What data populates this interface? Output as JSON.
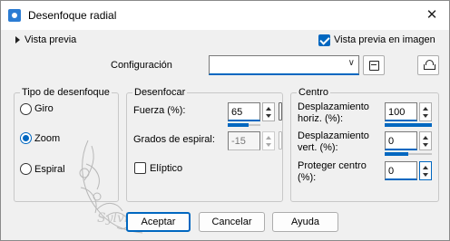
{
  "window": {
    "title": "Desenfoque radial",
    "close_glyph": "✕",
    "icon": "app-icon"
  },
  "preview": {
    "expander_label": "Vista previa",
    "in_image_label": "Vista previa en imagen",
    "in_image_checked": true
  },
  "config": {
    "label": "Configuración",
    "value": "",
    "save_icon": "save-icon",
    "reset_icon": "reset-defaults-icon"
  },
  "blur_type": {
    "legend": "Tipo de desenfoque",
    "options": [
      {
        "label": "Giro",
        "selected": false
      },
      {
        "label": "Zoom",
        "selected": true
      },
      {
        "label": "Espiral",
        "selected": false
      }
    ]
  },
  "blur": {
    "legend": "Desenfocar",
    "strength": {
      "label": "Fuerza (%):",
      "value": "65",
      "level": 0.65
    },
    "spiral": {
      "label": "Grados de espiral:",
      "value": "-15",
      "enabled": false
    },
    "elliptic": {
      "label": "Elíptico",
      "checked": false
    }
  },
  "center": {
    "legend": "Centro",
    "horiz": {
      "label_line1": "Desplazamiento",
      "label_line2": "horiz. (%):",
      "value": "100",
      "level": 1.0
    },
    "vert": {
      "label_line1": "Desplazamiento",
      "label_line2": "vert. (%):",
      "value": "0",
      "level": 0.5
    },
    "protect": {
      "label_line1": "Proteger centro",
      "label_line2": "(%):",
      "value": "0"
    }
  },
  "buttons": {
    "ok": "Aceptar",
    "cancel": "Cancelar",
    "help": "Ayuda"
  },
  "colors": {
    "accent": "#0067c0",
    "background": "#f0f0f0"
  }
}
